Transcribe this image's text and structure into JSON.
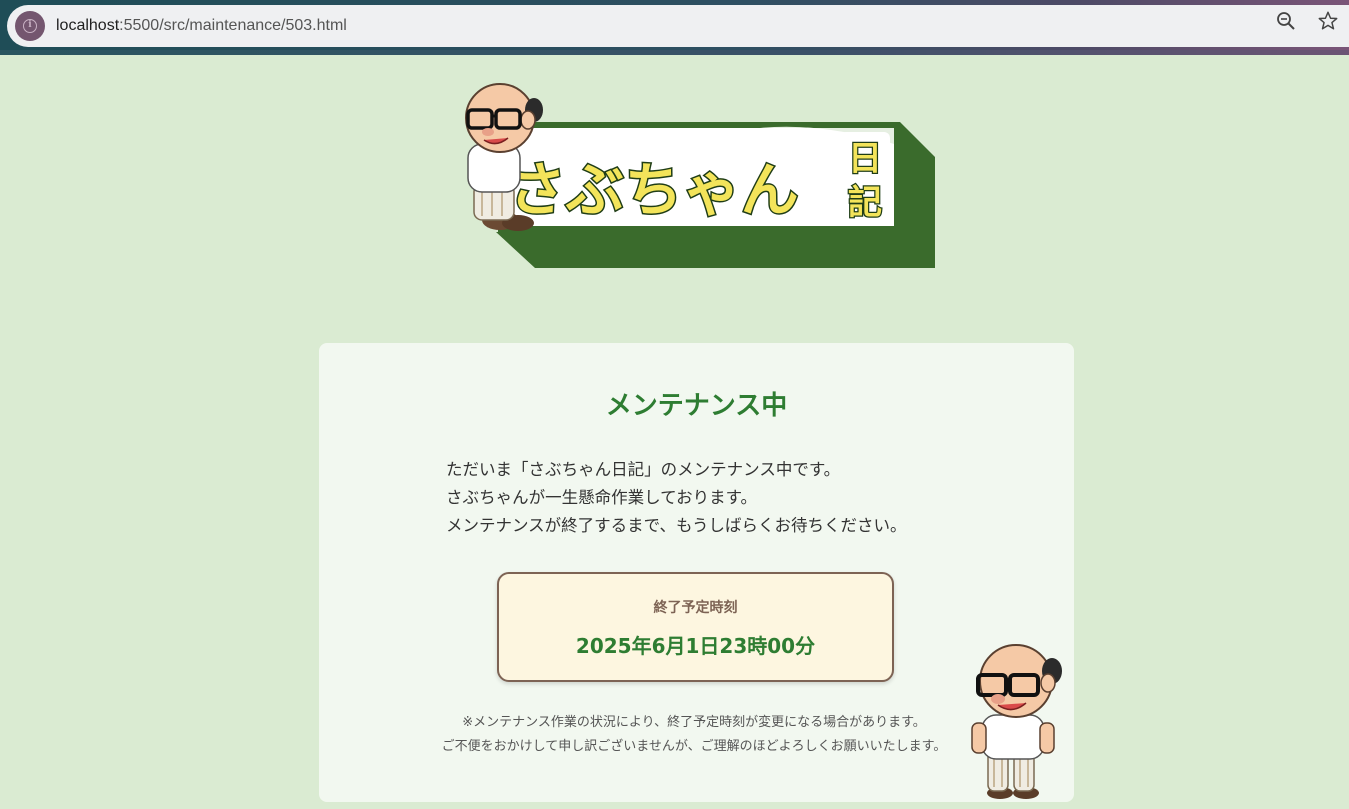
{
  "browser": {
    "url_host": "localhost",
    "url_path": ":5500/src/maintenance/503.html",
    "icons": [
      "site-info-icon",
      "zoom-out-icon",
      "bookmark-star-icon"
    ]
  },
  "logo": {
    "text_main": "さぶちゃん",
    "text_side": "日記",
    "colors": {
      "dark_green": "#3a6b2c",
      "yellow": "#f3e45a",
      "outline": "#1f3d16"
    }
  },
  "card": {
    "title": "メンテナンス中",
    "message_lines": [
      "ただいま「さぶちゃん日記」のメンテナンス中です。",
      "さぶちゃんが一生懸命作業しております。",
      "メンテナンスが終了するまで、もうしばらくお待ちください。"
    ],
    "schedule": {
      "label": "終了予定時刻",
      "time": "2025年6月1日23時00分"
    },
    "notes": [
      "※メンテナンス作業の状況により、終了予定時刻が変更になる場合があります。",
      "ご不便をおかけして申し訳ございませんが、ご理解のほどよろしくお願いいたします。"
    ]
  },
  "colors": {
    "page_bg": "#daebd2",
    "card_bg": "#f2f8f0",
    "accent_green": "#2e7d32",
    "brown": "#7d6354",
    "schedule_bg": "#fdf6e0"
  }
}
